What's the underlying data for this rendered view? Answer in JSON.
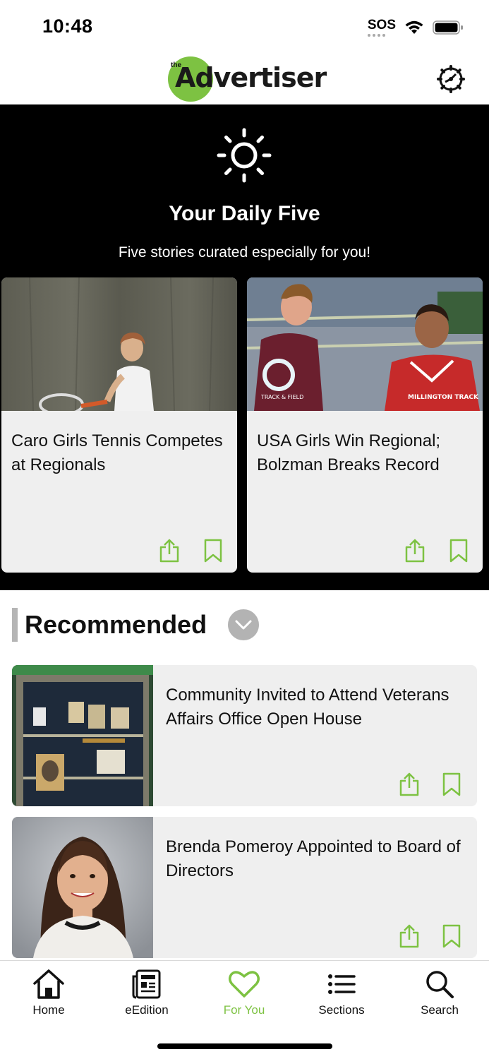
{
  "status": {
    "time": "10:48",
    "sos": "SOS"
  },
  "header": {
    "logo_the": "the",
    "logo_text": "Advertiser"
  },
  "daily": {
    "title": "Your Daily Five",
    "subtitle": "Five stories curated especially for you!",
    "cards": [
      {
        "title": "Caro Girls Tennis Competes at Regionals"
      },
      {
        "title": "USA Girls Win Regional; Bolzman Breaks Record",
        "jersey_left": "TRACK & FIELD",
        "jersey_right": "MILLINGTON TRACK"
      }
    ]
  },
  "recommended": {
    "heading": "Recommended",
    "items": [
      {
        "title": "Community Invited to Attend Veterans Affairs Office Open House"
      },
      {
        "title": "Brenda Pomeroy Appointed to Board of Directors"
      }
    ]
  },
  "tabs": [
    {
      "label": "Home",
      "icon": "home-icon"
    },
    {
      "label": "eEdition",
      "icon": "newspaper-icon"
    },
    {
      "label": "For You",
      "icon": "heart-icon",
      "active": true
    },
    {
      "label": "Sections",
      "icon": "list-icon"
    },
    {
      "label": "Search",
      "icon": "search-icon"
    }
  ],
  "colors": {
    "accent": "#7dc242",
    "dark": "#000000",
    "card_bg": "#efefef"
  }
}
